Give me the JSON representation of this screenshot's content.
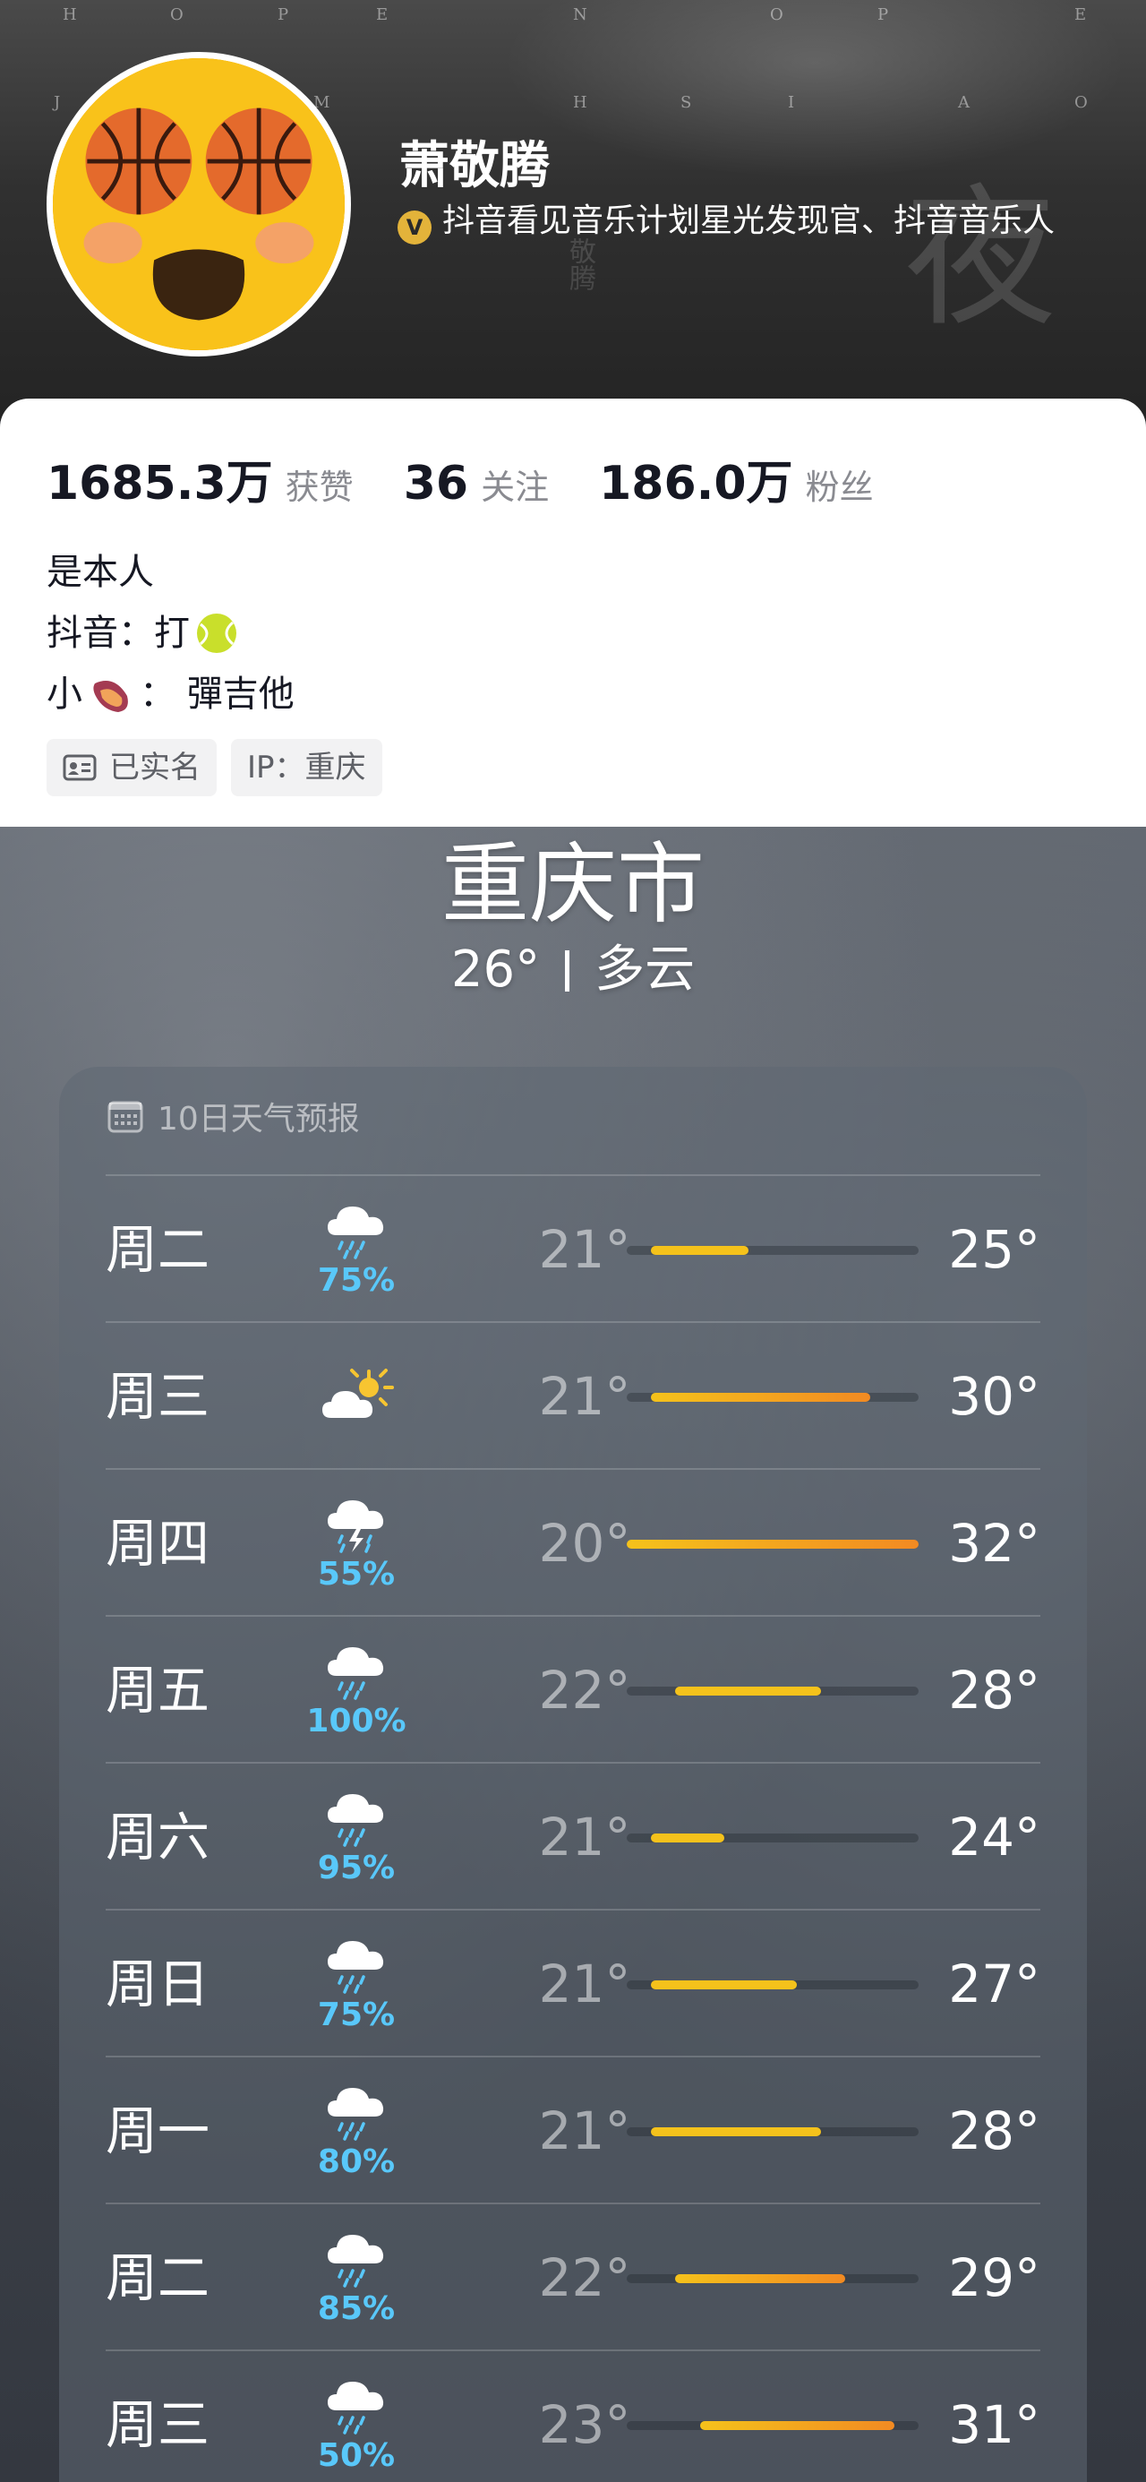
{
  "header": {
    "name": "萧敬腾",
    "verify_badge": "V",
    "verify_text": "抖音看见音乐计划星光发现官、抖音音乐人",
    "letters_row1": [
      "H",
      "O",
      "P",
      "E",
      "N",
      "O",
      "P",
      "E"
    ],
    "letters_row2": [
      "J",
      "M",
      "H",
      "S",
      "I",
      "A",
      "O"
    ],
    "deco_char": "夜",
    "deco_small": "敬腾"
  },
  "stats": [
    {
      "value": "1685.3万",
      "label": "获赞"
    },
    {
      "value": "36",
      "label": "关注"
    },
    {
      "value": "186.0万",
      "label": "粉丝"
    }
  ],
  "bio": {
    "line1": "是本人",
    "line2_prefix": "抖音：打",
    "line2_emoji": "tennis-ball",
    "line3_prefix": "小",
    "line3_emoji": "sweet-potato",
    "line3_suffix": "：  彈吉他"
  },
  "tags": {
    "verified": "已实名",
    "ip": "IP：重庆"
  },
  "weather": {
    "city": "重庆市",
    "temp": "26°",
    "condition": "多云",
    "panel_title": "10日天气预报",
    "range_min": 20,
    "range_max": 32,
    "days": [
      {
        "day": "周二",
        "icon": "cloud-rain-icon",
        "pct": "75%",
        "low": 21,
        "high": 25,
        "low_text": "21°",
        "high_text": "25°"
      },
      {
        "day": "周三",
        "icon": "partly-sunny-icon",
        "pct": "",
        "low": 21,
        "high": 30,
        "low_text": "21°",
        "high_text": "30°"
      },
      {
        "day": "周四",
        "icon": "thunderstorm-icon",
        "pct": "55%",
        "low": 20,
        "high": 32,
        "low_text": "20°",
        "high_text": "32°"
      },
      {
        "day": "周五",
        "icon": "cloud-rain-icon",
        "pct": "100%",
        "low": 22,
        "high": 28,
        "low_text": "22°",
        "high_text": "28°"
      },
      {
        "day": "周六",
        "icon": "cloud-rain-icon",
        "pct": "95%",
        "low": 21,
        "high": 24,
        "low_text": "21°",
        "high_text": "24°"
      },
      {
        "day": "周日",
        "icon": "cloud-rain-icon",
        "pct": "75%",
        "low": 21,
        "high": 27,
        "low_text": "21°",
        "high_text": "27°"
      },
      {
        "day": "周一",
        "icon": "cloud-rain-icon",
        "pct": "80%",
        "low": 21,
        "high": 28,
        "low_text": "21°",
        "high_text": "28°"
      },
      {
        "day": "周二",
        "icon": "cloud-rain-icon",
        "pct": "85%",
        "low": 22,
        "high": 29,
        "low_text": "22°",
        "high_text": "29°"
      },
      {
        "day": "周三",
        "icon": "cloud-rain-icon",
        "pct": "50%",
        "low": 23,
        "high": 31,
        "low_text": "23°",
        "high_text": "31°"
      }
    ]
  },
  "colors": {
    "avatar": "#f6b300",
    "bar_cool": "#f5c21b",
    "bar_warm": "#f28a22",
    "precip": "#59c8fa"
  }
}
